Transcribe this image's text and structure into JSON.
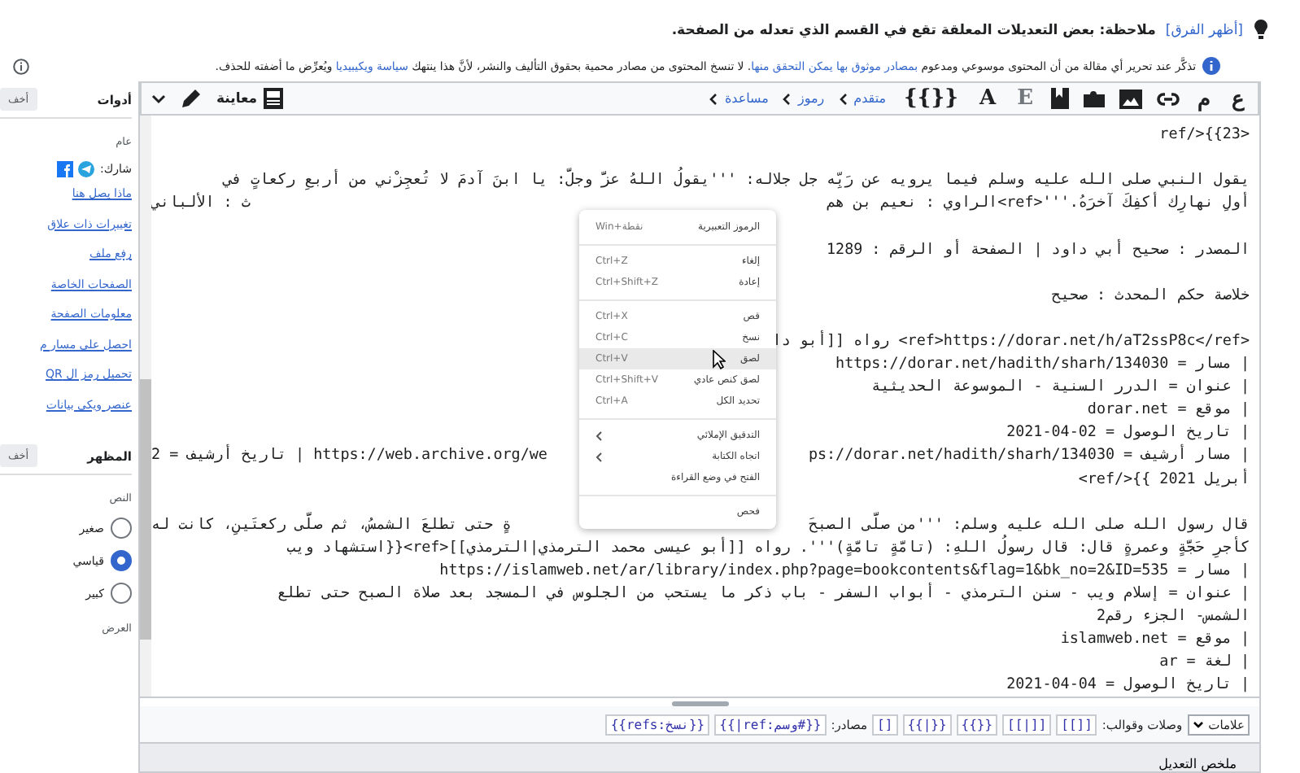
{
  "notice": {
    "link": "[أظهر الفرق]",
    "text": "ملاحظة: بعض التعديلات المعلقة تقع في القسم الذي تعدله من الصفحة."
  },
  "reminder": [
    {
      "text": "تذكَّر عند تحرير أي مقالة من أن المحتوى موسوعي ومدعوم ",
      "link": false
    },
    {
      "text": "بمصادر موثوق بها يمكن التحقق منها",
      "link": true
    },
    {
      "text": ". لا تنسخ المحتوى من مصادر محمية بحقوق التأليف والنشر، لأنَّ هذا ينتهك ",
      "link": false
    },
    {
      "text": "سياسة ويكيبيديا",
      "link": true
    },
    {
      "text": " ويُعرِّض ما أضفته للحذف.",
      "link": false
    }
  ],
  "sidebar": {
    "tools": {
      "title": "أدوات",
      "hide": "أخف",
      "general": "عام",
      "share": "شارك:",
      "links": [
        "ماذا يصل هنا",
        "تغييرات ذات علاق",
        "رفع ملف",
        "الصفحات الخاصة",
        "معلومات الصفحة",
        "احصل على مسار م",
        "تحميل رمز ال QR",
        "عنصر ويكي بيانات"
      ]
    },
    "appearance": {
      "title": "المظهر",
      "hide": "أخف",
      "text_label": "النص",
      "options": [
        {
          "label": "صغير",
          "selected": false
        },
        {
          "label": "قياسي",
          "selected": true
        },
        {
          "label": "كبير",
          "selected": false
        }
      ],
      "width_label": "العرض"
    }
  },
  "toolbar": {
    "format": [
      "ع",
      "م"
    ],
    "glyphs": [
      "E",
      "A",
      "{{}}"
    ],
    "menus": [
      "متقدم",
      "رموز",
      "مساعدة"
    ],
    "preview": "معاينة"
  },
  "editor": {
    "lines": [
      {
        "kind": "code",
        "text": "<ref/>{{23"
      },
      {
        "kind": "blank"
      },
      {
        "kind": "code",
        "text": "يقول النبي صلى الله عليه وسلم فيما يرويه عن رَبِّه جل جلاله: '''يقولُ اللهُ عزَّ وجلَّ: يا ابنَ آدمَ لا تُعجِزْني من أربعِ ركعاتٍ في"
      },
      {
        "kind": "code",
        "text": "أولِ نهارِك أكفِكَ آخرَهُ.'''<ref>الراوي : نعيم بن هم",
        "tail": "ث : الألباني"
      },
      {
        "kind": "blank"
      },
      {
        "kind": "code",
        "text": "المصدر : صحيح أبي داود | الصفحة أو الرقم : 1289"
      },
      {
        "kind": "blank"
      },
      {
        "kind": "code",
        "text": "خلاصة حكم المحدث : صحيح"
      },
      {
        "kind": "blank"
      },
      {
        "kind": "code",
        "text": "<ref>https://dorar.net/h/aT2ssP8c</ref> رواه [[أبو دا"
      },
      {
        "kind": "code",
        "text": "| مسار = https://dorar.net/hadith/sharh/134030"
      },
      {
        "kind": "code",
        "text": "| عنوان = الدرر السنية - الموسوعة الحديثية"
      },
      {
        "kind": "code",
        "text": "| موقع = dorar.net"
      },
      {
        "kind": "code",
        "text": "| تاريخ الوصول = 02-04-2021"
      },
      {
        "kind": "code",
        "text": "| مسار أرشيف = ps://dorar.net/hadith/sharh/134030",
        "tail": "https://web.archive.org/we | تاريخ أرشيف = 2"
      },
      {
        "kind": "code",
        "text": "أبريل 2021 }}</ref>"
      },
      {
        "kind": "blank"
      },
      {
        "kind": "code",
        "text": "قال رسول الله صلى الله عليه وسلم: '''من صلَّى الصبحَ",
        "tail": "ةٍ حتى تطلعَ الشمسُ، ثم صلَّى ركعتَينِ، كانت له"
      },
      {
        "kind": "code",
        "text": "كأجرِ حَجَّةٍ وعمرةٍ قال: قال رسولُ اللهِ: (تامَّةٍ تامَّةٍ)'''. رواه [[أبو عيسى محمد الترمذي|الترمذي]]<ref>{{استشهاد ويب"
      },
      {
        "kind": "code",
        "text": "| مسار = https://islamweb.net/ar/library/index.php?page=bookcontents&flag=1&bk_no=2&ID=535"
      },
      {
        "kind": "code",
        "text": "| عنوان = إسلام ويب - سنن الترمذي - أبواب السفر - باب ذكر ما يستحب من الجلوس في المسجد بعد صلاة الصبح حتى تطلع"
      },
      {
        "kind": "code",
        "text": "الشمس- الجزء رقم2"
      },
      {
        "kind": "code",
        "text": "| موقع = islamweb.net"
      },
      {
        "kind": "code",
        "text": "| لغة = ar"
      },
      {
        "kind": "code",
        "text": "| تاريخ الوصول = 04-04-2021"
      }
    ]
  },
  "context_menu": {
    "groups": [
      [
        {
          "label": "الرموز التعبيرية",
          "shortcut": "Win+نقطة",
          "selected": false
        }
      ],
      [
        {
          "label": "إلغاء",
          "shortcut": "Ctrl+Z",
          "selected": false
        },
        {
          "label": "إعادة",
          "shortcut": "Ctrl+Shift+Z",
          "selected": false
        }
      ],
      [
        {
          "label": "قص",
          "shortcut": "Ctrl+X",
          "selected": false
        },
        {
          "label": "نسخ",
          "shortcut": "Ctrl+C",
          "selected": false
        },
        {
          "label": "لصق",
          "shortcut": "Ctrl+V",
          "selected": true
        },
        {
          "label": "لصق كنص عادي",
          "shortcut": "Ctrl+Shift+V",
          "selected": false
        },
        {
          "label": "تحديد الكل",
          "shortcut": "Ctrl+A",
          "selected": false
        }
      ],
      [
        {
          "label": "التدقيق الإملائي",
          "submenu": true,
          "selected": false
        },
        {
          "label": "اتجاه الكتابة",
          "submenu": true,
          "selected": false
        },
        {
          "label": "الفتح في وضع القراءة",
          "selected": false
        }
      ],
      [
        {
          "label": "فحص",
          "selected": false
        }
      ]
    ]
  },
  "charbar": {
    "select": "علامات",
    "links_label": "وصلات وقوالب:",
    "link_buttons": [
      "[[]]",
      "[[|]]",
      "{{}}",
      "{{|}}",
      "[]"
    ],
    "refs_label": "مصادر:",
    "ref_buttons": [
      "{{#وسم:ref|}}",
      "{{نسخ:refs}}"
    ]
  },
  "summary_label": "ملخص التعديل"
}
